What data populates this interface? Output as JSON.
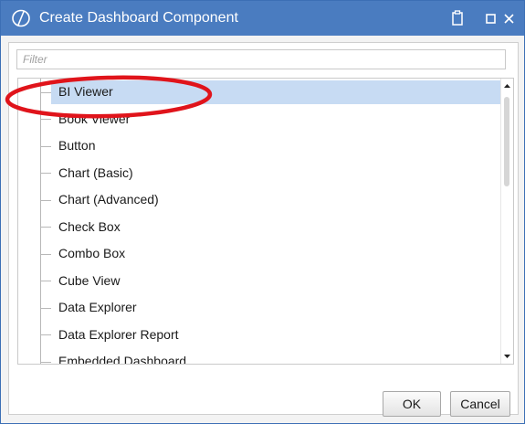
{
  "window": {
    "title": "Create Dashboard Component",
    "logo_icon": "onestream-logo-icon",
    "controls": [
      "clipboard-icon",
      "maximize-icon",
      "close-icon"
    ]
  },
  "filter": {
    "placeholder": "Filter",
    "value": ""
  },
  "components": [
    {
      "label": "BI Viewer",
      "selected": true
    },
    {
      "label": "Book Viewer",
      "selected": false
    },
    {
      "label": "Button",
      "selected": false
    },
    {
      "label": "Chart (Basic)",
      "selected": false
    },
    {
      "label": "Chart (Advanced)",
      "selected": false
    },
    {
      "label": "Check Box",
      "selected": false
    },
    {
      "label": "Combo Box",
      "selected": false
    },
    {
      "label": "Cube View",
      "selected": false
    },
    {
      "label": "Data Explorer",
      "selected": false
    },
    {
      "label": "Data Explorer Report",
      "selected": false
    },
    {
      "label": "Embedded Dashboard",
      "selected": false
    }
  ],
  "buttons": {
    "ok_label": "OK",
    "cancel_label": "Cancel"
  },
  "colors": {
    "titlebar": "#4a7cc0",
    "selection": "#c7dbf3",
    "annotation_ring": "#e0141b"
  }
}
